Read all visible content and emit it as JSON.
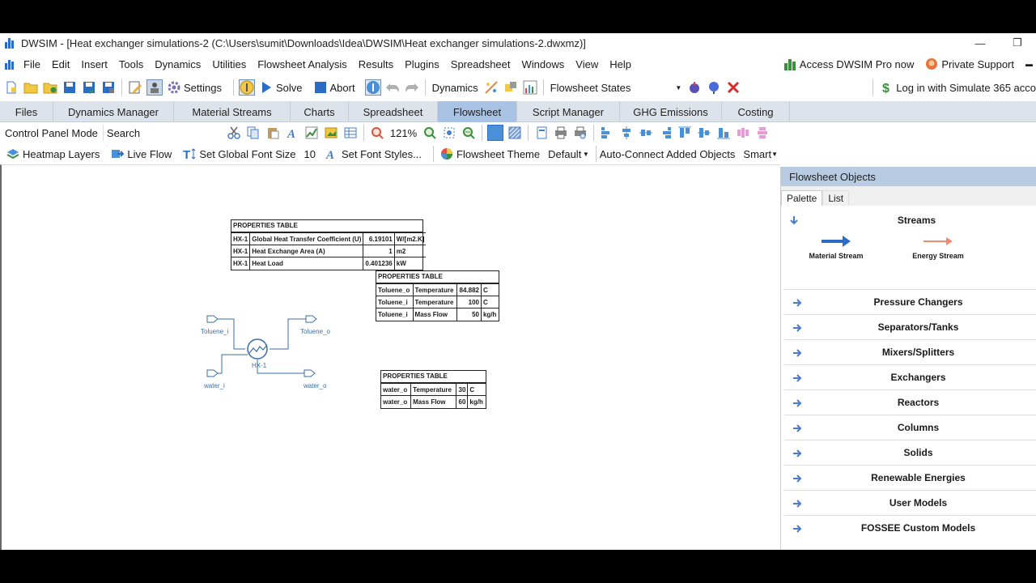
{
  "window": {
    "title": "DWSIM - [Heat exchanger simulations-2 (C:\\Users\\sumit\\Downloads\\Idea\\DWSIM\\Heat exchanger simulations-2.dwxmz)]",
    "minimize": "—",
    "restore": "❐"
  },
  "menu": {
    "items": [
      "File",
      "Edit",
      "Insert",
      "Tools",
      "Dynamics",
      "Utilities",
      "Flowsheet Analysis",
      "Results",
      "Plugins",
      "Spreadsheet",
      "Windows",
      "View",
      "Help"
    ],
    "pro_label": "Access DWSIM Pro now",
    "support_label": "Private Support",
    "collapse": "▬"
  },
  "toolbar1": {
    "settings": "Settings",
    "solve": "Solve",
    "abort": "Abort",
    "dynamics": "Dynamics",
    "flowsheet_states": "Flowsheet States",
    "login": "Log in with Simulate 365 acco"
  },
  "tabs": [
    "Files",
    "Dynamics Manager",
    "Material Streams",
    "Charts",
    "Spreadsheet",
    "Flowsheet",
    "Script Manager",
    "GHG Emissions",
    "Costing"
  ],
  "active_tab": "Flowsheet",
  "toolbar2": {
    "mode": "Control Panel Mode",
    "search_label": "Search",
    "zoom": "121%"
  },
  "toolbar3": {
    "heatmap": "Heatmap Layers",
    "liveflow": "Live Flow",
    "global_font": "Set Global Font Size",
    "font_size": "10",
    "font_styles": "Set Font Styles...",
    "theme_label": "Flowsheet Theme",
    "theme_value": "Default",
    "autoconnect_label": "Auto-Connect Added Objects",
    "autoconnect_value": "Smart"
  },
  "tables": {
    "hx": {
      "title": "PROPERTIES TABLE",
      "rows": [
        [
          "HX-1",
          "Global Heat Transfer Coefficient (U)",
          "6.19101",
          "W/[m2.K]"
        ],
        [
          "HX-1",
          "Heat Exchange Area (A)",
          "1",
          "m2"
        ],
        [
          "HX-1",
          "Heat Load",
          "0.401236",
          "kW"
        ]
      ]
    },
    "toluene": {
      "title": "PROPERTIES TABLE",
      "rows": [
        [
          "Toluene_o",
          "Temperature",
          "84.882",
          "C"
        ],
        [
          "Toluene_i",
          "Temperature",
          "100",
          "C"
        ],
        [
          "Toluene_i",
          "Mass Flow",
          "50",
          "kg/h"
        ]
      ]
    },
    "water": {
      "title": "PROPERTIES TABLE",
      "rows": [
        [
          "water_o",
          "Temperature",
          "30",
          "C"
        ],
        [
          "water_o",
          "Mass Flow",
          "60",
          "kg/h"
        ]
      ]
    }
  },
  "diagram": {
    "toluene_i": "Toluene_i",
    "toluene_o": "Toluene_o",
    "water_i": "water_i",
    "water_o": "water_o",
    "hx": "HX-1"
  },
  "panel": {
    "title": "Flowsheet Objects",
    "tab_palette": "Palette",
    "tab_list": "List",
    "streams_header": "Streams",
    "material_stream": "Material Stream",
    "energy_stream": "Energy Stream",
    "categories": [
      "Pressure Changers",
      "Separators/Tanks",
      "Mixers/Splitters",
      "Exchangers",
      "Reactors",
      "Columns",
      "Solids",
      "Renewable Energies",
      "User Models",
      "FOSSEE Custom Models"
    ]
  },
  "colors": {
    "accent": "#2b6cc4",
    "active_tab": "#a9c3e4",
    "tab_bar": "#dde3ea",
    "panel_header": "#b7cbe3",
    "stream_line": "#3a6ea5",
    "energy_stream": "#f08a6c"
  }
}
